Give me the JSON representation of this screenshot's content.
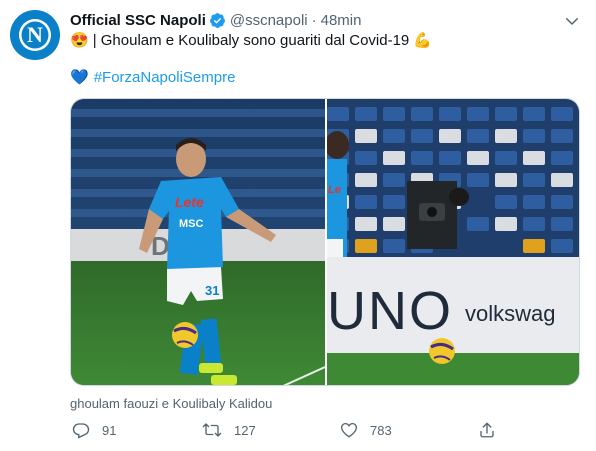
{
  "tweet": {
    "display_name": "Official SSC Napoli",
    "handle": "@sscnapoli",
    "separator": "·",
    "time": "48min",
    "line1_emoji": "😍",
    "line1_text": "| Ghoulam e Koulibaly sono guariti dal Covid-19",
    "line1_emoji_end": "💪",
    "line2_emoji": "💙",
    "hashtag": "#ForzaNapoliSempre",
    "media_caption": "ghoulam faouzi e Koulibaly Kalidou",
    "jersey_sponsor": "Lete",
    "jersey_brand": "MSC",
    "jersey_number": "31",
    "board_text_left": "UNO",
    "board_text_right": "volkswag",
    "board_text_bg": "DA"
  },
  "actions": {
    "replies": "91",
    "retweets": "127",
    "likes": "783"
  },
  "colors": {
    "accent": "#1d9bf0",
    "napoli_blue": "#0a80c8",
    "muted": "#536471"
  },
  "icons": [
    "napoli-logo-icon",
    "verified-badge-icon",
    "more-icon",
    "reply-icon",
    "retweet-icon",
    "like-icon",
    "share-icon"
  ]
}
